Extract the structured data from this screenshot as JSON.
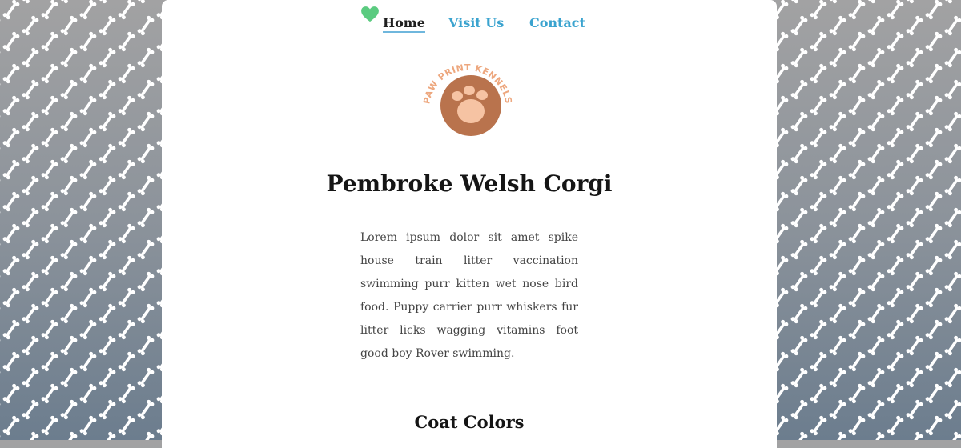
{
  "nav": {
    "items": [
      {
        "label": "Home",
        "active": true
      },
      {
        "label": "Visit Us",
        "active": false
      },
      {
        "label": "Contact",
        "active": false
      }
    ],
    "heart_icon": "heart-icon",
    "heart_color": "#5bcb80",
    "link_color": "#3aa3cf"
  },
  "logo": {
    "text": "PAW PRINT KENNELS",
    "icon": "paw-icon",
    "circle_color": "#b9734d",
    "pad_color": "#f6c3a3",
    "text_color": "#eda77e"
  },
  "main": {
    "title": "Pembroke Welsh Corgi",
    "paragraph": "Lorem ipsum dolor sit amet spike house train litter vaccination swimming purr kitten wet nose bird food. Puppy carrier purr whiskers fur litter licks wagging vitamins foot good boy Rover swimming.",
    "section_heading": "Coat Colors"
  },
  "background": {
    "pattern_icon": "bone-icon",
    "gradient_top": "#a2a2a3",
    "gradient_bottom": "#6c7d8e"
  }
}
